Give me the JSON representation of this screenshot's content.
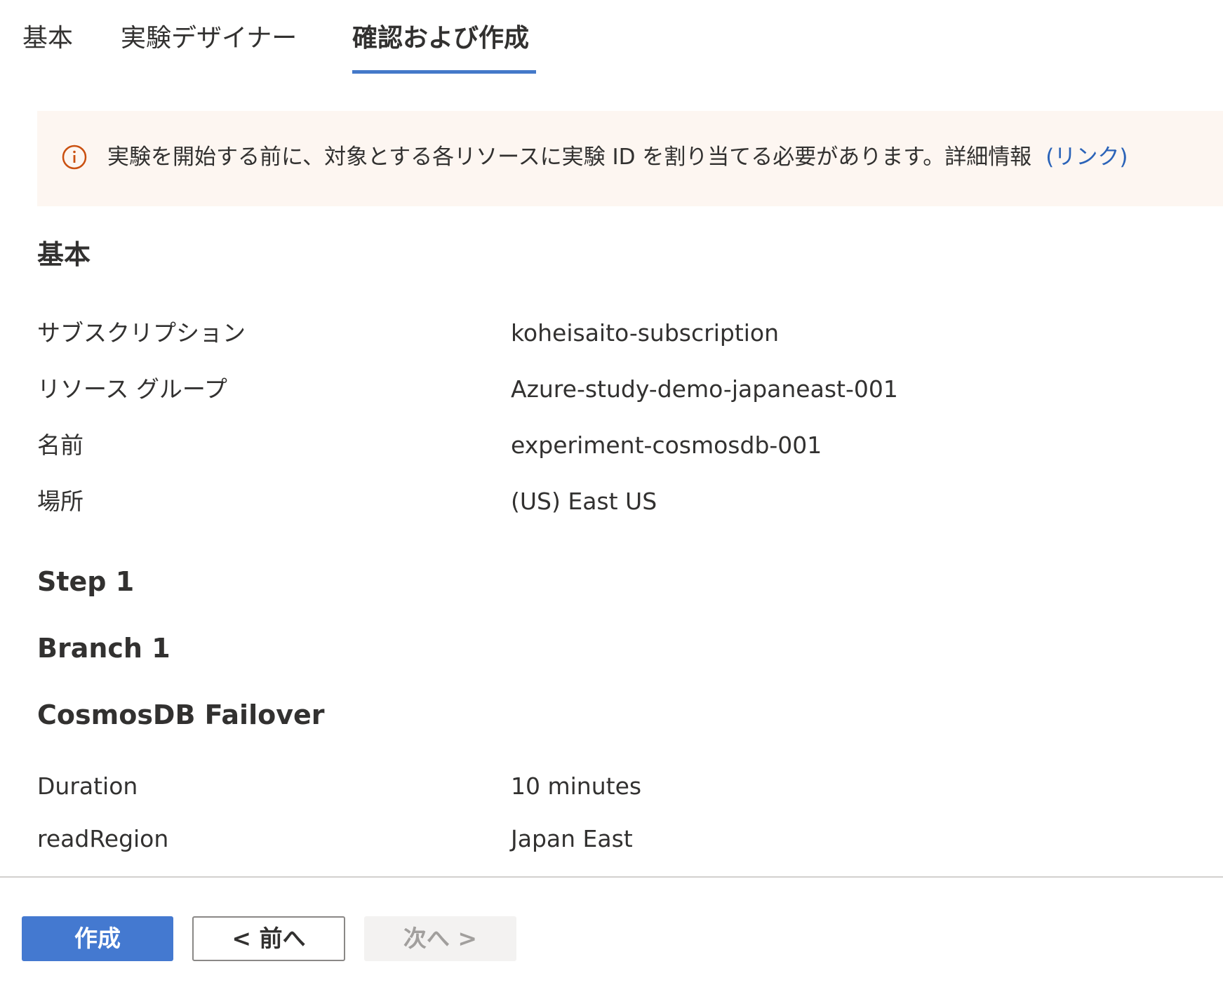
{
  "tabs": [
    {
      "label": "基本",
      "active": false
    },
    {
      "label": "実験デザイナー",
      "active": false
    },
    {
      "label": "確認および作成",
      "active": true
    }
  ],
  "banner": {
    "icon": "info-circle-icon",
    "icon_color": "#ca5010",
    "text": "実験を開始する前に、対象とする各リソースに実験 ID を割り当てる必要があります。詳細情報",
    "link_label": "(リンク)"
  },
  "basics": {
    "heading": "基本",
    "rows": [
      {
        "label": "サブスクリプション",
        "value": "koheisaito-subscription"
      },
      {
        "label": "リソース グループ",
        "value": "Azure-study-demo-japaneast-001"
      },
      {
        "label": "名前",
        "value": "experiment-cosmosdb-001"
      },
      {
        "label": "場所",
        "value": "(US) East US"
      }
    ]
  },
  "step": {
    "heading": "Step 1"
  },
  "branch": {
    "heading": "Branch 1"
  },
  "fault": {
    "heading": "CosmosDB Failover",
    "rows": [
      {
        "label": "Duration",
        "value": "10 minutes"
      },
      {
        "label": "readRegion",
        "value": "Japan East"
      }
    ]
  },
  "footer": {
    "create_label": "作成",
    "prev_label": "< 前へ",
    "next_label": "次へ >"
  },
  "colors": {
    "accent": "#4479c9",
    "link": "#2b63b8",
    "banner_bg": "#fdf6f1"
  }
}
